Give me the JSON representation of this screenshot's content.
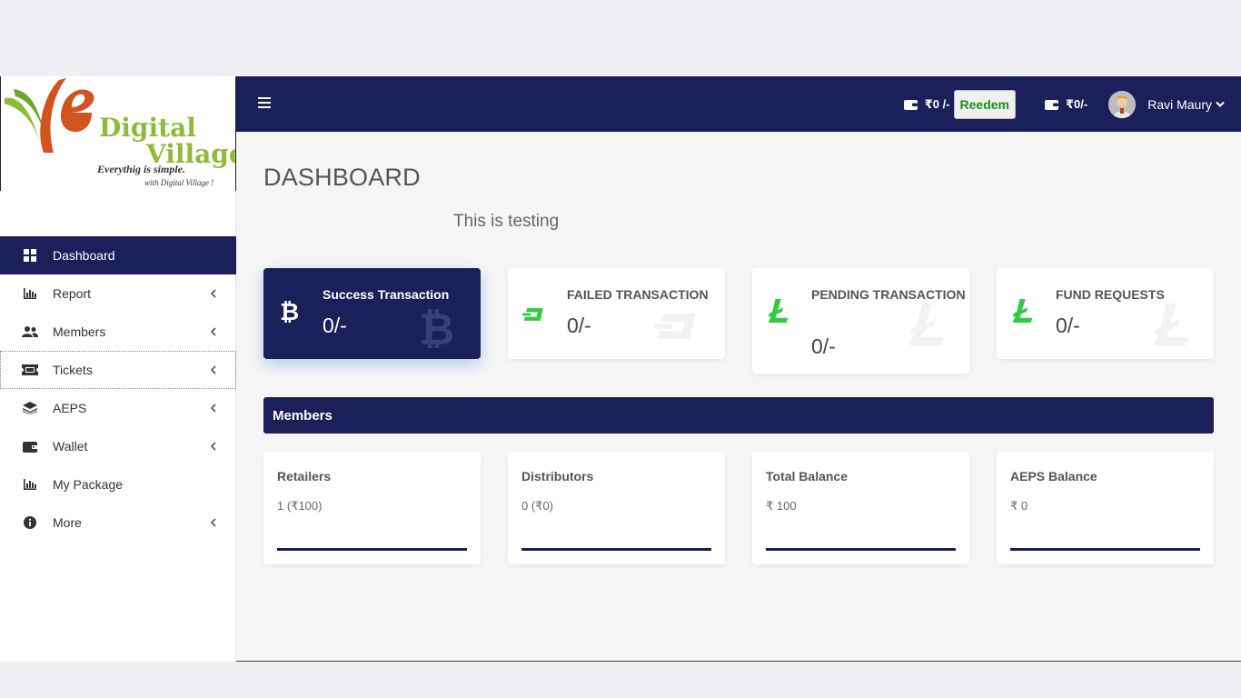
{
  "logo": {
    "brand_line1": "Digital",
    "brand_line2": "Village",
    "tagline": "Everythig is simple.",
    "subline": "with Digital Village !"
  },
  "sidebar": {
    "items": [
      {
        "label": "Dashboard",
        "icon": "dashboard-icon",
        "active": true
      },
      {
        "label": "Report",
        "icon": "bar-chart-icon"
      },
      {
        "label": "Members",
        "icon": "users-icon"
      },
      {
        "label": "Tickets",
        "icon": "ticket-icon"
      },
      {
        "label": "AEPS",
        "icon": "layers-icon"
      },
      {
        "label": "Wallet",
        "icon": "wallet-icon"
      },
      {
        "label": "My Package",
        "icon": "bar-chart-icon"
      },
      {
        "label": "More",
        "icon": "info-icon"
      }
    ]
  },
  "topbar": {
    "wallet1_amount": "₹0 /-",
    "redeem_label": "Reedem",
    "wallet2_amount": "₹0/-",
    "user_name": "Ravi Maury"
  },
  "page": {
    "title": "DASHBOARD",
    "notice": "This is testing"
  },
  "stats": [
    {
      "title": "Success Transaction",
      "value": "0/-",
      "icon": "bitcoin-icon"
    },
    {
      "title": "FAILED TRANSACTION",
      "value": "0/-",
      "icon": "dash-icon"
    },
    {
      "title": "PENDING TRANSACTION",
      "value": "0/-",
      "icon": "litecoin-icon"
    },
    {
      "title": "FUND REQUESTS",
      "value": "0/-",
      "icon": "litecoin-icon"
    }
  ],
  "members": {
    "header": "Members",
    "cards": [
      {
        "title": "Retailers",
        "value": "1 (₹100)"
      },
      {
        "title": "Distributors",
        "value": "0 (₹0)"
      },
      {
        "title": "Total Balance",
        "value": "₹ 100"
      },
      {
        "title": "AEPS Balance",
        "value": "₹ 0"
      }
    ]
  },
  "colors": {
    "brand_navy": "#1b1f5a",
    "icon_green": "#2ecc40",
    "redeem_text": "#1a8f1a",
    "logo_orange": "#d2531d",
    "logo_green": "#8cbc3a"
  }
}
